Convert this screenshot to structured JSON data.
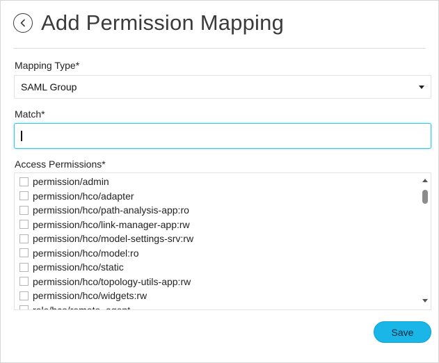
{
  "header": {
    "title": "Add Permission Mapping",
    "back_icon": "chevron-left-circle-icon"
  },
  "mapping_type": {
    "label": "Mapping Type*",
    "selected": "SAML Group"
  },
  "match": {
    "label": "Match*",
    "value": ""
  },
  "access_permissions": {
    "label": "Access Permissions*",
    "items": [
      "permission/admin",
      "permission/hco/adapter",
      "permission/hco/path-analysis-app:ro",
      "permission/hco/link-manager-app:rw",
      "permission/hco/model-settings-srv:rw",
      "permission/hco/model:ro",
      "permission/hco/static",
      "permission/hco/topology-utils-app:rw",
      "permission/hco/widgets:rw",
      "role/hco/remote_agent"
    ]
  },
  "footer": {
    "save_label": "Save"
  },
  "colors": {
    "accent": "#1ab6e8",
    "focus_border": "#3fc3e2"
  }
}
